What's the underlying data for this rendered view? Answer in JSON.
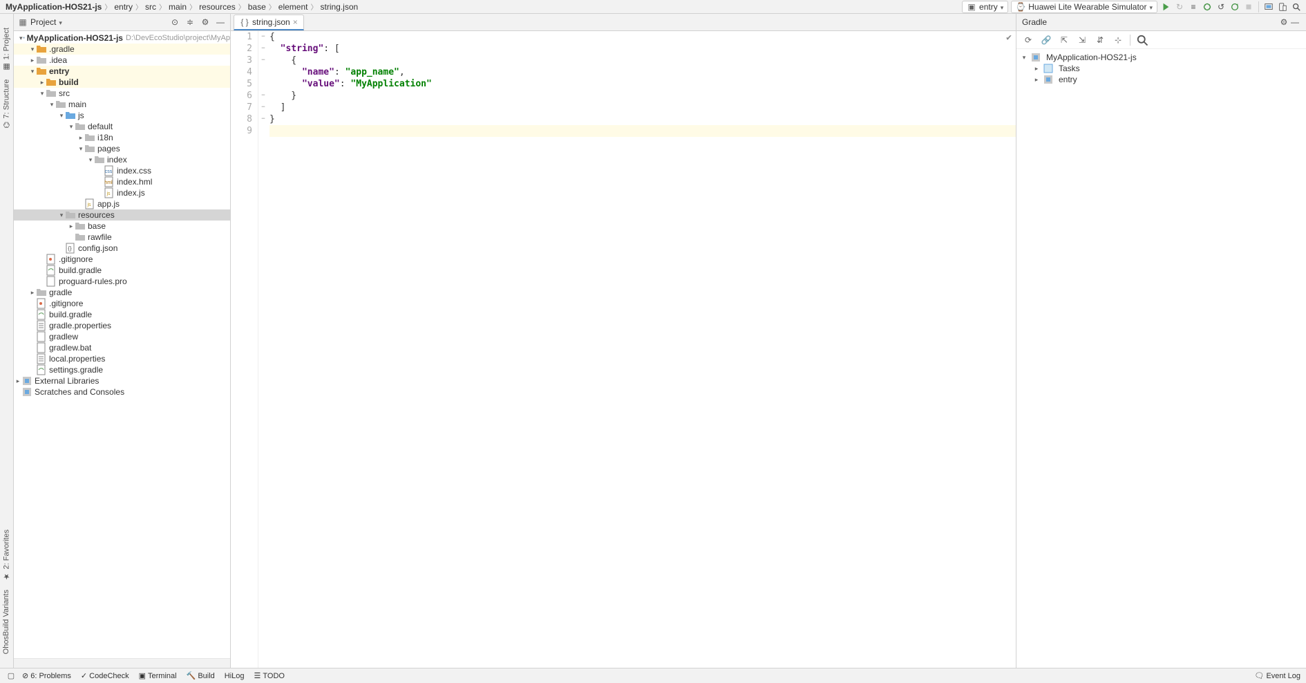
{
  "breadcrumbs": [
    "MyApplication-HOS21-js",
    "entry",
    "src",
    "main",
    "resources",
    "base",
    "element",
    "string.json"
  ],
  "topbar": {
    "entry_combo": "entry",
    "device_combo": "Huawei Lite Wearable Simulator"
  },
  "project_panel": {
    "title": "Project",
    "root_name": "MyApplication-HOS21-js",
    "root_path": "D:\\DevEcoStudio\\project\\MyAp",
    "tree": [
      {
        "d": 1,
        "arrow": "v",
        "icon": "folder-open",
        "hl": true,
        "label": ".gradle"
      },
      {
        "d": 1,
        "arrow": ">",
        "icon": "gray-folder",
        "label": ".idea"
      },
      {
        "d": 1,
        "arrow": "v",
        "icon": "folder-open",
        "hl": true,
        "bold": true,
        "label": "entry"
      },
      {
        "d": 2,
        "arrow": ">",
        "icon": "folder-open",
        "hl": true,
        "bold": true,
        "label": "build"
      },
      {
        "d": 2,
        "arrow": "v",
        "icon": "gray-folder",
        "label": "src"
      },
      {
        "d": 3,
        "arrow": "v",
        "icon": "gray-folder",
        "label": "main"
      },
      {
        "d": 4,
        "arrow": "v",
        "icon": "blue-folder",
        "label": "js"
      },
      {
        "d": 5,
        "arrow": "v",
        "icon": "gray-folder",
        "label": "default"
      },
      {
        "d": 6,
        "arrow": ">",
        "icon": "gray-folder",
        "label": "i18n"
      },
      {
        "d": 6,
        "arrow": "v",
        "icon": "gray-folder",
        "label": "pages"
      },
      {
        "d": 7,
        "arrow": "v",
        "icon": "gray-folder",
        "label": "index"
      },
      {
        "d": 8,
        "arrow": "",
        "icon": "css",
        "label": "index.css"
      },
      {
        "d": 8,
        "arrow": "",
        "icon": "hml",
        "label": "index.hml"
      },
      {
        "d": 8,
        "arrow": "",
        "icon": "js",
        "label": "index.js"
      },
      {
        "d": 6,
        "arrow": "",
        "icon": "js",
        "label": "app.js"
      },
      {
        "d": 4,
        "arrow": "v",
        "icon": "gray-folder",
        "sel": true,
        "label": "resources"
      },
      {
        "d": 5,
        "arrow": ">",
        "icon": "gray-folder",
        "label": "base"
      },
      {
        "d": 5,
        "arrow": "",
        "icon": "gray-folder",
        "label": "rawfile"
      },
      {
        "d": 4,
        "arrow": "",
        "icon": "json",
        "label": "config.json"
      },
      {
        "d": 2,
        "arrow": "",
        "icon": "git",
        "label": ".gitignore"
      },
      {
        "d": 2,
        "arrow": "",
        "icon": "gradle",
        "label": "build.gradle"
      },
      {
        "d": 2,
        "arrow": "",
        "icon": "file",
        "label": "proguard-rules.pro"
      },
      {
        "d": 1,
        "arrow": ">",
        "icon": "gray-folder",
        "label": "gradle"
      },
      {
        "d": 1,
        "arrow": "",
        "icon": "git",
        "label": ".gitignore"
      },
      {
        "d": 1,
        "arrow": "",
        "icon": "gradle",
        "label": "build.gradle"
      },
      {
        "d": 1,
        "arrow": "",
        "icon": "prop",
        "label": "gradle.properties"
      },
      {
        "d": 1,
        "arrow": "",
        "icon": "file",
        "label": "gradlew"
      },
      {
        "d": 1,
        "arrow": "",
        "icon": "file",
        "label": "gradlew.bat"
      },
      {
        "d": 1,
        "arrow": "",
        "icon": "prop",
        "label": "local.properties"
      },
      {
        "d": 1,
        "arrow": "",
        "icon": "gradle",
        "label": "settings.gradle"
      }
    ],
    "ext_lib": "External Libraries",
    "scratches": "Scratches and Consoles"
  },
  "left_gutter": {
    "project": "1: Project",
    "structure": "7: Structure",
    "favorites": "2: Favorites",
    "variants": "OhosBuild Variants"
  },
  "editor": {
    "tab_name": "string.json",
    "lines": [
      {
        "n": 1,
        "fold": "−",
        "html": "{"
      },
      {
        "n": 2,
        "fold": "−",
        "html": "  <span class='k'>\"string\"</span>: ["
      },
      {
        "n": 3,
        "fold": "−",
        "html": "    {"
      },
      {
        "n": 4,
        "fold": "",
        "html": "      <span class='k'>\"name\"</span>: <span class='s'>\"app_name\"</span>,"
      },
      {
        "n": 5,
        "fold": "",
        "html": "      <span class='k'>\"value\"</span>: <span class='s'>\"MyApplication\"</span>"
      },
      {
        "n": 6,
        "fold": "−",
        "html": "    }"
      },
      {
        "n": 7,
        "fold": "−",
        "html": "  ]"
      },
      {
        "n": 8,
        "fold": "−",
        "html": "}"
      },
      {
        "n": 9,
        "fold": "",
        "html": "",
        "cur": true
      }
    ]
  },
  "gradle_panel": {
    "title": "Gradle",
    "root": "MyApplication-HOS21-js",
    "children": [
      {
        "icon": "tasks",
        "label": "Tasks"
      },
      {
        "icon": "module",
        "label": "entry"
      }
    ]
  },
  "status": {
    "problems": "6: Problems",
    "codecheck": "CodeCheck",
    "terminal": "Terminal",
    "build": "Build",
    "hilog": "HiLog",
    "todo": "TODO",
    "eventlog": "Event Log"
  }
}
